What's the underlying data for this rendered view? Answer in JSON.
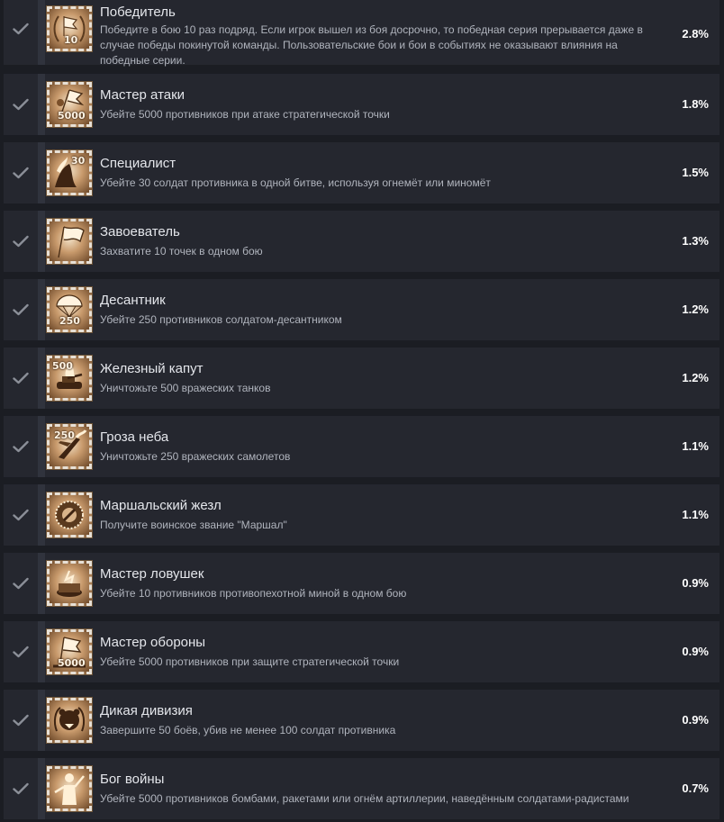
{
  "achievements": [
    {
      "title": "Победитель",
      "description": "Победите в бою 10 раз подряд. Если игрок вышел из боя досрочно, то победная серия прерывается даже в случае победы покинутой команды. Пользовательские бои и бои в событиях не оказывают влияния на победные серии.",
      "percent": "2.8%",
      "icon": "laurel-wreath-flag-icon",
      "badge": "10"
    },
    {
      "title": "Мастер атаки",
      "description": "Убейте 5000 противников при атаке стратегической точки",
      "percent": "1.8%",
      "icon": "attack-flag-icon",
      "badge": "5000"
    },
    {
      "title": "Специалист",
      "description": "Убейте 30 солдат противника в одной битве, используя огнемёт или миномёт",
      "percent": "1.5%",
      "icon": "flamethrower-soldier-icon",
      "badge": "30"
    },
    {
      "title": "Завоеватель",
      "description": "Захватите 10 точек в одном бою",
      "percent": "1.3%",
      "icon": "conquest-flag-icon",
      "badge": ""
    },
    {
      "title": "Десантник",
      "description": "Убейте 250 противников солдатом-десантником",
      "percent": "1.2%",
      "icon": "parachute-icon",
      "badge": "250"
    },
    {
      "title": "Железный капут",
      "description": "Уничтожьте 500 вражеских танков",
      "percent": "1.2%",
      "icon": "burning-tank-icon",
      "badge": "500"
    },
    {
      "title": "Гроза неба",
      "description": "Уничтожьте 250 вражеских самолетов",
      "percent": "1.1%",
      "icon": "falling-plane-icon",
      "badge": "250"
    },
    {
      "title": "Маршальский жезл",
      "description": "Получите воинское звание \"Маршал\"",
      "percent": "1.1%",
      "icon": "marshal-baton-medal-icon",
      "badge": ""
    },
    {
      "title": "Мастер ловушек",
      "description": "Убейте 10 противников противопехотной миной в одном бою",
      "percent": "0.9%",
      "icon": "landmine-icon",
      "badge": ""
    },
    {
      "title": "Мастер обороны",
      "description": "Убейте 5000 противников при защите стратегической точки",
      "percent": "0.9%",
      "icon": "defense-flag-icon",
      "badge": "5000"
    },
    {
      "title": "Дикая дивизия",
      "description": "Завершите 50 боёв, убив не менее 100 солдат противника",
      "percent": "0.9%",
      "icon": "bear-head-wreath-icon",
      "badge": ""
    },
    {
      "title": "Бог войны",
      "description": "Убейте 5000 противников бомбами, ракетами или огнём артиллерии, наведённым солдатами-радистами",
      "percent": "0.7%",
      "icon": "god-of-war-statue-icon",
      "badge": ""
    }
  ],
  "colors": {
    "background": "#1b1d23",
    "row": "#25272f",
    "check": "#8b8f98",
    "title": "#e4e6eb",
    "description": "#b0b4bd",
    "percent": "#ffffff"
  }
}
